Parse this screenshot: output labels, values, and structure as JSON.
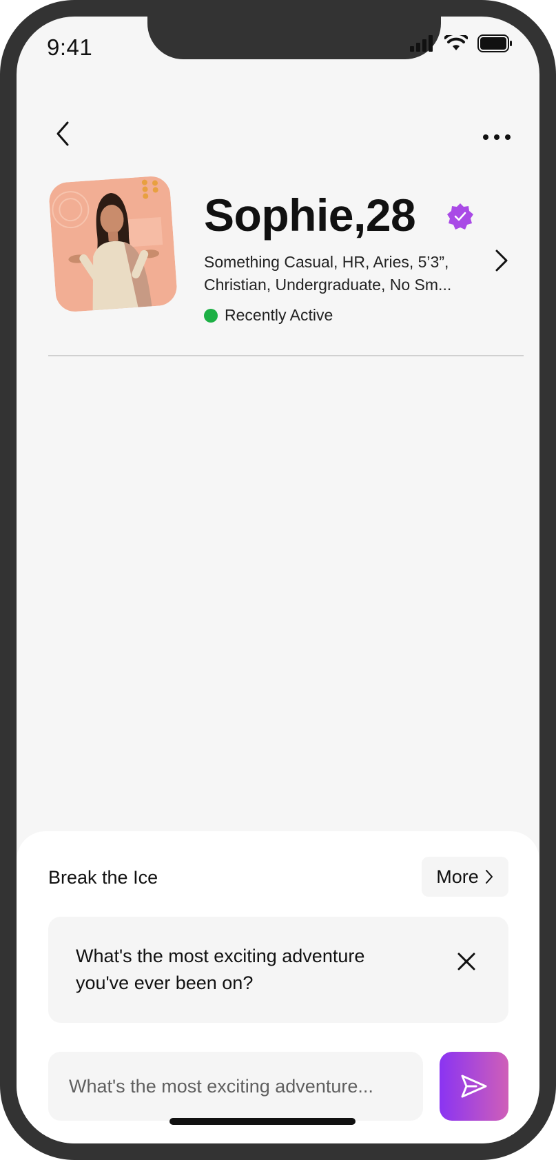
{
  "status_bar": {
    "time": "9:41"
  },
  "profile": {
    "name_age": "Sophie,28",
    "details_line1": "Something Casual, HR, Aries, 5’3”,",
    "details_line2": "Christian, Undergraduate, No Sm...",
    "activity_status": "Recently Active",
    "verified": true
  },
  "icebreaker": {
    "title": "Break the Ice",
    "more_label": "More",
    "suggestion": "What's the most exciting adventure you've ever been on?"
  },
  "composer": {
    "placeholder": "What's the most exciting adventure..."
  },
  "colors": {
    "accent_start": "#8a34f2",
    "accent_end": "#cf5fb8",
    "verified_badge": "#a94ae6",
    "active_dot": "#1db045",
    "frame": "#333333"
  },
  "icons": [
    "back-arrow-icon",
    "more-options-icon",
    "verified-badge-icon",
    "chevron-right-icon",
    "close-icon",
    "send-icon",
    "signal-icon",
    "wifi-icon",
    "battery-icon"
  ]
}
